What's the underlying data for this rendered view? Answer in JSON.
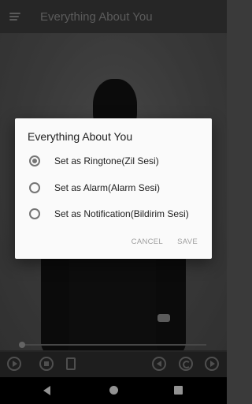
{
  "app_bar": {
    "title": "Everything About You",
    "menu_icon": "menu-icon"
  },
  "player": {
    "controls": [
      "play-icon",
      "stop-icon",
      "exit-icon",
      "previous-icon",
      "repeat-icon",
      "next-icon"
    ]
  },
  "dialog": {
    "title": "Everything About You",
    "options": [
      {
        "label": "Set as Ringtone(Zil Sesi)",
        "selected": true
      },
      {
        "label": "Set as Alarm(Alarm Sesi)",
        "selected": false
      },
      {
        "label": "Set as Notification(Bildirim Sesi)",
        "selected": false
      }
    ],
    "cancel_label": "CANCEL",
    "save_label": "SAVE"
  },
  "navigation": {
    "icons": [
      "back-icon",
      "home-icon",
      "recents-icon"
    ]
  }
}
